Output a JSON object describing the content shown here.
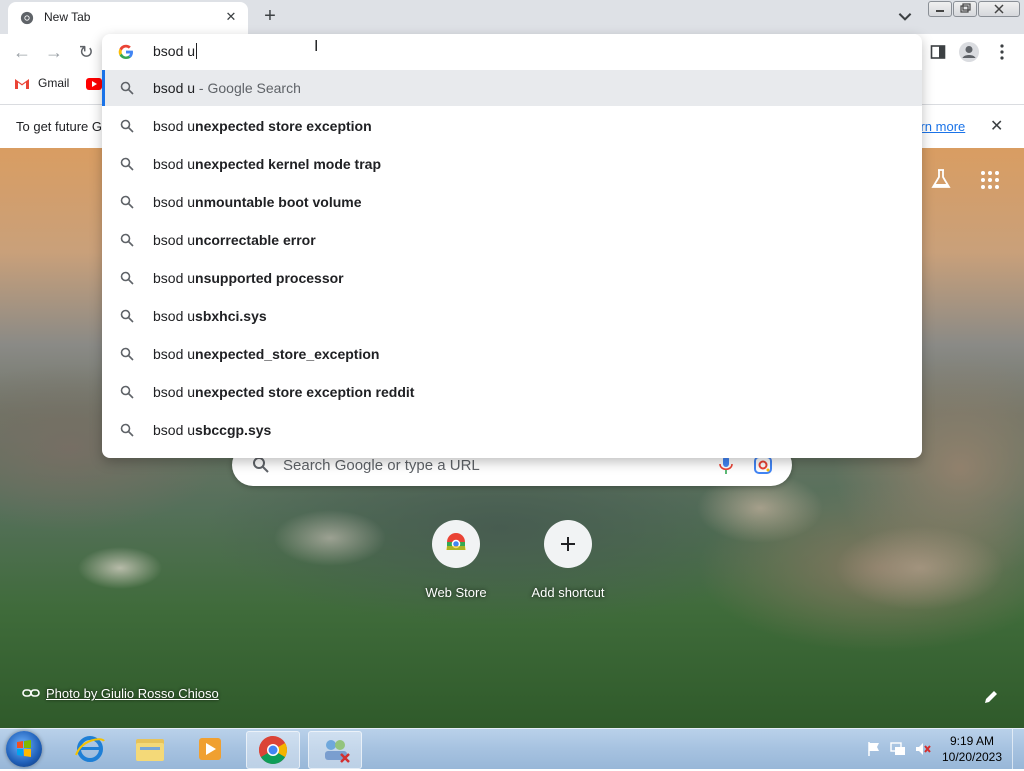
{
  "browser": {
    "tab_title": "New Tab",
    "bookmarks": [
      {
        "label": "Gmail"
      }
    ]
  },
  "infobar": {
    "text": "To get future G",
    "link": "earn more"
  },
  "omnibox": {
    "input_value": "bsod u",
    "suggestions": [
      {
        "prefix": "bsod u",
        "bold": "",
        "desc": " - Google Search"
      },
      {
        "prefix": "bsod u",
        "bold": "nexpected store exception",
        "desc": ""
      },
      {
        "prefix": "bsod u",
        "bold": "nexpected kernel mode trap",
        "desc": ""
      },
      {
        "prefix": "bsod u",
        "bold": "nmountable boot volume",
        "desc": ""
      },
      {
        "prefix": "bsod u",
        "bold": "ncorrectable error",
        "desc": ""
      },
      {
        "prefix": "bsod u",
        "bold": "nsupported processor",
        "desc": ""
      },
      {
        "prefix": "bsod u",
        "bold": "sbxhci.sys",
        "desc": ""
      },
      {
        "prefix": "bsod u",
        "bold": "nexpected_store_exception",
        "desc": ""
      },
      {
        "prefix": "bsod u",
        "bold": "nexpected store exception reddit",
        "desc": ""
      },
      {
        "prefix": "bsod u",
        "bold": "sbccgp.sys",
        "desc": ""
      }
    ]
  },
  "ntp": {
    "search_placeholder": "Search Google or type a URL",
    "shortcuts": [
      {
        "label": "Web Store"
      },
      {
        "label": "Add shortcut"
      }
    ],
    "photo_credit": "Photo by Giulio Rosso Chioso"
  },
  "taskbar": {
    "time": "9:19 AM",
    "date": "10/20/2023"
  },
  "colors": {
    "accent": "#1a73e8",
    "selected_row": "#e8eaed"
  }
}
